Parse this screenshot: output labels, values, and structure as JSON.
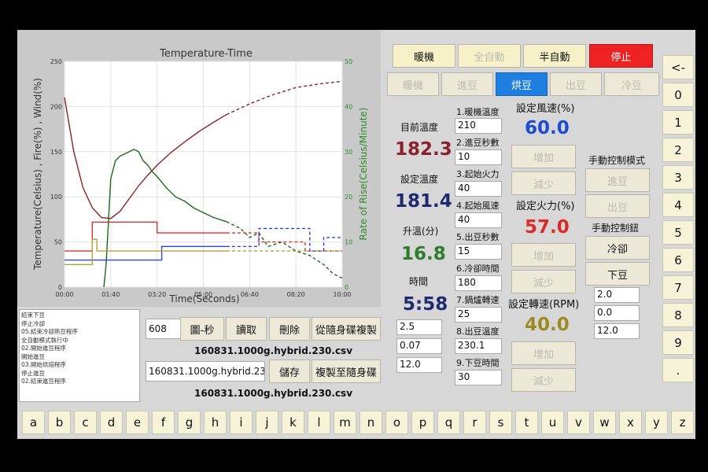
{
  "chart_data": {
    "type": "line",
    "title": "Temperature-Time",
    "xlabel": "Time(Seconds)",
    "ylabel_left": "Temperature(Celsius) , Fire(%) , Wind(%)",
    "ylabel_right": "Rate of Rise(Celsius/Minute)",
    "xlim": [
      0,
      600
    ],
    "ylim_left": [
      0,
      250
    ],
    "ylim_right": [
      0,
      50
    ],
    "x_ticks": [
      "00:00",
      "01:40",
      "03:20",
      "05:00",
      "06:40",
      "08:20",
      "10:00"
    ],
    "y_ticks_left": [
      "0",
      "50",
      "100",
      "150",
      "200",
      "250"
    ],
    "y_ticks_right": [
      "0",
      "10",
      "20",
      "30",
      "40",
      "50"
    ],
    "grid": true,
    "series": [
      {
        "id": "bt",
        "axis": "left",
        "color": "#8b2323",
        "x": [
          0,
          10,
          20,
          40,
          60,
          80,
          100,
          120,
          140,
          160,
          180,
          200,
          230,
          260,
          290,
          320,
          350
        ],
        "y": [
          210,
          180,
          150,
          110,
          88,
          77,
          76,
          84,
          98,
          112,
          124,
          135,
          149,
          161,
          172,
          182,
          191
        ]
      },
      {
        "id": "bt_projection",
        "axis": "left",
        "color": "#8b2323",
        "dashed": true,
        "x": [
          350,
          400,
          450,
          500,
          550,
          600
        ],
        "y": [
          191,
          203,
          213,
          221,
          225,
          228
        ]
      },
      {
        "id": "ror",
        "axis": "right",
        "color": "#1a6b1a",
        "x": [
          85,
          90,
          100,
          110,
          120,
          130,
          140,
          150,
          160,
          170,
          180,
          190,
          200,
          220,
          240,
          260,
          280,
          300,
          320,
          350
        ],
        "y": [
          0,
          5,
          24,
          28,
          29,
          29.5,
          30,
          30.5,
          30,
          28,
          27,
          25.5,
          24.5,
          22,
          20,
          19,
          17.5,
          16.5,
          15.5,
          14.5
        ]
      },
      {
        "id": "ror_projection",
        "axis": "right",
        "color": "#1a6b1a",
        "dashed": true,
        "x": [
          350,
          380,
          400,
          420,
          440,
          470,
          500,
          530,
          560,
          580,
          600
        ],
        "y": [
          14.5,
          13,
          11,
          12,
          9,
          10,
          8,
          7,
          5,
          3,
          2
        ]
      },
      {
        "id": "set_temp",
        "axis": "left",
        "color": "#e03030",
        "x": [
          0,
          30,
          60,
          60,
          200,
          200,
          350
        ],
        "y": [
          40,
          40,
          40,
          72,
          72,
          60,
          60
        ]
      },
      {
        "id": "set_temp_projection",
        "axis": "left",
        "color": "#e03030",
        "dashed": true,
        "x": [
          350,
          420,
          420,
          520,
          520,
          600
        ],
        "y": [
          60,
          60,
          50,
          50,
          40,
          40
        ]
      },
      {
        "id": "wind",
        "axis": "left",
        "color": "#2846d8",
        "x": [
          0,
          60,
          60,
          210,
          210,
          260,
          260,
          350
        ],
        "y": [
          30,
          30,
          30,
          30,
          45,
          45,
          45,
          45
        ]
      },
      {
        "id": "wind_projection",
        "axis": "left",
        "color": "#2846d8",
        "dashed": true,
        "x": [
          350,
          420,
          420,
          530,
          530,
          560,
          560,
          600
        ],
        "y": [
          45,
          45,
          65,
          65,
          40,
          40,
          55,
          55
        ]
      },
      {
        "id": "fire",
        "axis": "left",
        "color": "#b0a33a",
        "x": [
          0,
          60,
          60,
          70,
          70,
          350
        ],
        "y": [
          25,
          25,
          53,
          53,
          40,
          40
        ]
      },
      {
        "id": "fire_projection",
        "axis": "left",
        "color": "#b0a33a",
        "dashed": true,
        "x": [
          350,
          600
        ],
        "y": [
          40,
          40
        ]
      }
    ]
  },
  "mode_buttons": {
    "preheat": "暖機",
    "auto": "全自動",
    "semi": "半自動",
    "stop": "停止"
  },
  "stage_tabs": [
    "暖機",
    "進豆",
    "烘豆",
    "出豆",
    "冷豆"
  ],
  "status": {
    "current_temp_label": "目前溫度",
    "current_temp": "182.3",
    "set_temp_label": "設定溫度",
    "set_temp": "181.4",
    "ror_label": "升溫(分)",
    "ror": "16.8",
    "time_label": "時間",
    "time": "5:58"
  },
  "params": [
    {
      "label": "1.暖機溫度",
      "value": "210"
    },
    {
      "label": "2.進豆秒數",
      "value": "10"
    },
    {
      "label": "3.起始火力",
      "value": "40"
    },
    {
      "label": "4.起始風速",
      "value": "40"
    },
    {
      "label": "5.出豆秒數",
      "value": "15"
    },
    {
      "label": "6.冷卻時間",
      "value": "180"
    },
    {
      "label": "7.鍋爐轉速",
      "value": "25"
    },
    {
      "label": "8.出豆溫度",
      "value": "230.1"
    },
    {
      "label": "9.下豆時間",
      "value": "30"
    }
  ],
  "controls": {
    "wind_label": "設定風速(%)",
    "wind_value": "60.0",
    "fire_label": "設定火力(%)",
    "fire_value": "57.0",
    "rpm_label": "設定轉速(RPM)",
    "rpm_value": "40.0",
    "increase": "增加",
    "decrease": "減少"
  },
  "manual": {
    "mode_label": "手動控制模式",
    "bean_in": "進豆",
    "bean_out": "出豆",
    "button_label": "手動控制鈕",
    "cool": "冷卻",
    "drop": "下豆"
  },
  "side_values": [
    "2.0",
    "0.0",
    "12.0"
  ],
  "mid_values": [
    "2.5",
    "0.07",
    "12.0"
  ],
  "log_lines": [
    "結束下豆",
    "停止冷卻",
    "05.結束冷卻熱豆程序",
    "全自動模式執行中",
    "02.開始進豆程序",
    "開始進豆",
    "03.開始烘焙程序",
    "停止進豆",
    "02.結束進豆程序"
  ],
  "file_tools": {
    "count": "608",
    "plot_sec": "圖-秒",
    "read": "讀取",
    "delete": "刪除",
    "copy_from_usb": "從隨身碟複製",
    "current_file": "160831.1000g.hybrid.230.csv",
    "filename_input": "160831.1000g.hybrid.230",
    "save": "儲存",
    "copy_to_usb": "複製至隨身碟",
    "saved_file": "160831.1000g.hybrid.230.csv"
  },
  "numpad": [
    "<-",
    "0",
    "1",
    "2",
    "3",
    "4",
    "5",
    "6",
    "7",
    "8",
    "9",
    "."
  ],
  "keyboard": [
    "a",
    "b",
    "c",
    "d",
    "e",
    "f",
    "g",
    "h",
    "i",
    "j",
    "k",
    "l",
    "m",
    "n",
    "o",
    "p",
    "q",
    "r",
    "s",
    "t",
    "u",
    "v",
    "w",
    "x",
    "y",
    "z"
  ]
}
